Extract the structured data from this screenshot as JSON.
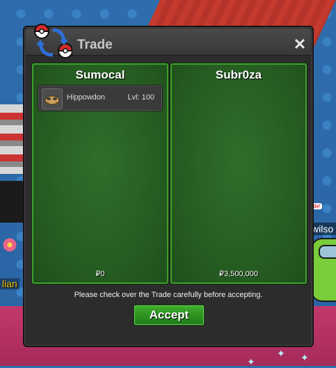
{
  "window": {
    "title": "Trade",
    "close_glyph": "✕",
    "notice": "Please check over the Trade carefully before accepting.",
    "accept_label": "Accept"
  },
  "trade": {
    "left": {
      "player_name": "Sumocal",
      "money": "₽0",
      "items": [
        {
          "name": "Hippowdon",
          "level": "Lvl: 100",
          "icon": "hippowdon-sprite-icon"
        }
      ]
    },
    "right": {
      "player_name": "Subr0za",
      "money": "₽3,500,000",
      "items": []
    }
  },
  "world": {
    "npc_left_name": "lian",
    "npc_right_name": "wilso",
    "npc_right_bubble": "ttle!"
  },
  "colors": {
    "panel_green": "#245a20",
    "panel_border": "#3fa02f",
    "accept_green": "#2f9524",
    "window_bg": "#2c2c2c"
  }
}
